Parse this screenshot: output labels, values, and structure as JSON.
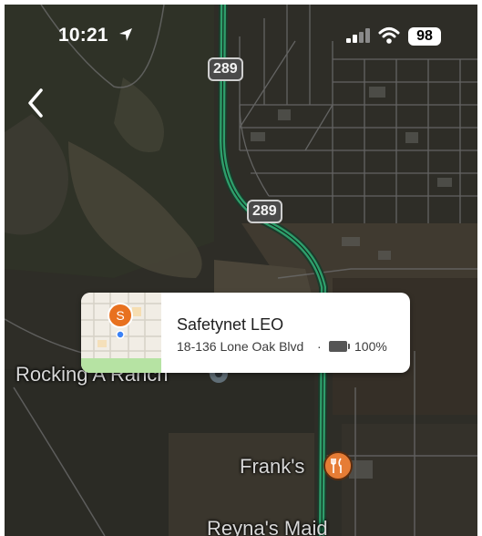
{
  "status_bar": {
    "time": "10:21",
    "battery": "98"
  },
  "map": {
    "route_shields": [
      "289",
      "289"
    ],
    "labels": {
      "rocking_a_ranch": "Rocking A Ranch",
      "franks": "Frank's",
      "reynas": "Reyna's Maid"
    },
    "colors": {
      "highway": "#2e9e6b",
      "poi": "#e67c35",
      "marker": "#e8711f"
    }
  },
  "place_card": {
    "marker_letter": "S",
    "name": "Safetynet LEO",
    "address": "18-136 Lone Oak Blvd",
    "separator": "·",
    "battery_percent": "100%"
  },
  "icons": [
    "location-arrow-icon",
    "cellular-signal-icon",
    "wifi-icon",
    "battery-icon",
    "back-chevron-icon",
    "restaurant-icon",
    "map-pin-icon"
  ]
}
